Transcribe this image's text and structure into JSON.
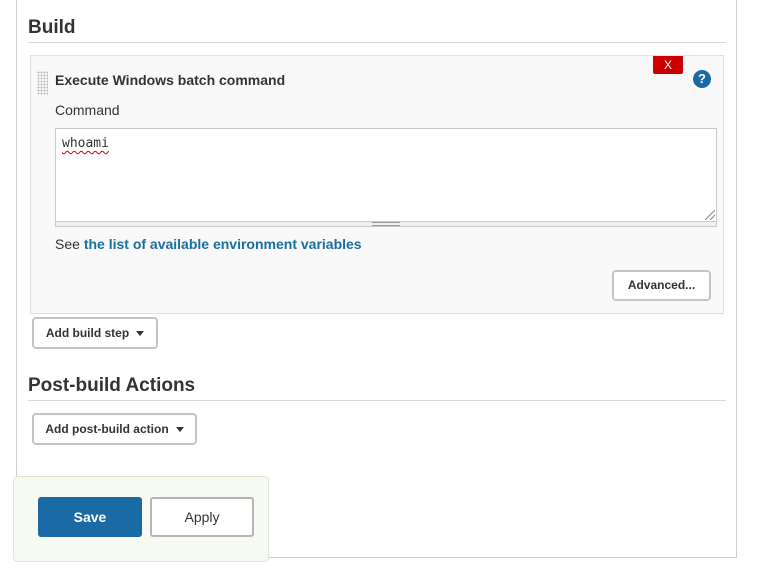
{
  "build": {
    "title": "Build",
    "step": {
      "title": "Execute Windows batch command",
      "delete_label": "X",
      "help_label": "?",
      "command_label": "Command",
      "command_value": "whoami",
      "env_prefix": "See ",
      "env_link": "the list of available environment variables",
      "advanced_label": "Advanced..."
    },
    "add_step_label": "Add build step"
  },
  "post_build": {
    "title": "Post-build Actions",
    "add_action_label": "Add post-build action"
  },
  "footer": {
    "save_label": "Save",
    "apply_label": "Apply"
  },
  "colors": {
    "accent": "#1a6aa5",
    "danger": "#cc0000",
    "link": "#1a6e9e"
  }
}
